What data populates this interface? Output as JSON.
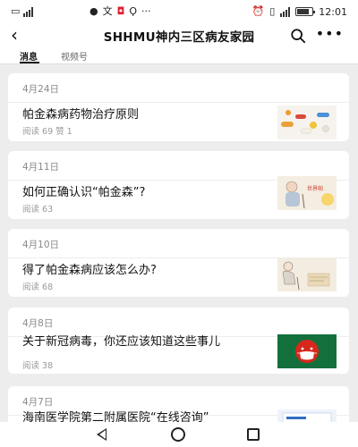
{
  "status": {
    "time": "12:01",
    "center_icons": [
      "message-icon",
      "translate-icon",
      "red-app-icon",
      "search-app-icon",
      "ellipsis-icon"
    ]
  },
  "header": {
    "title": "SHHMU神内三区病友家园",
    "back_icon": "chevron-left-icon",
    "search_icon": "search-icon",
    "more_icon": "more-dots-icon"
  },
  "tabs": [
    {
      "label": "消息",
      "active": true
    },
    {
      "label": "视频号",
      "active": false
    }
  ],
  "articles": [
    {
      "date": "4月24日",
      "title": "帕金森病药物治疗原则",
      "stats": "阅读 69   赞 1",
      "thumb": "pills"
    },
    {
      "date": "4月11日",
      "title": "如何正确认识“帕金森”?",
      "stats": "阅读 63",
      "thumb": "elderly-day"
    },
    {
      "date": "4月10日",
      "title": "得了帕金森病应该怎么办?",
      "stats": "阅读 68",
      "thumb": "elderly-sketch"
    },
    {
      "date": "4月8日",
      "title": "关于新冠病毒，你还应该知道这些事儿",
      "stats": "阅读 38",
      "thumb": "mask-emoji"
    },
    {
      "date": "4月7日",
      "title": "海南医学院第二附属医院“在线咨询”",
      "stats": "",
      "thumb": "document"
    }
  ],
  "colors": {
    "background": "#ededed",
    "card": "#ffffff",
    "mask_thumb_bg": "#13703d",
    "mask_thumb_face": "#d6281c"
  }
}
